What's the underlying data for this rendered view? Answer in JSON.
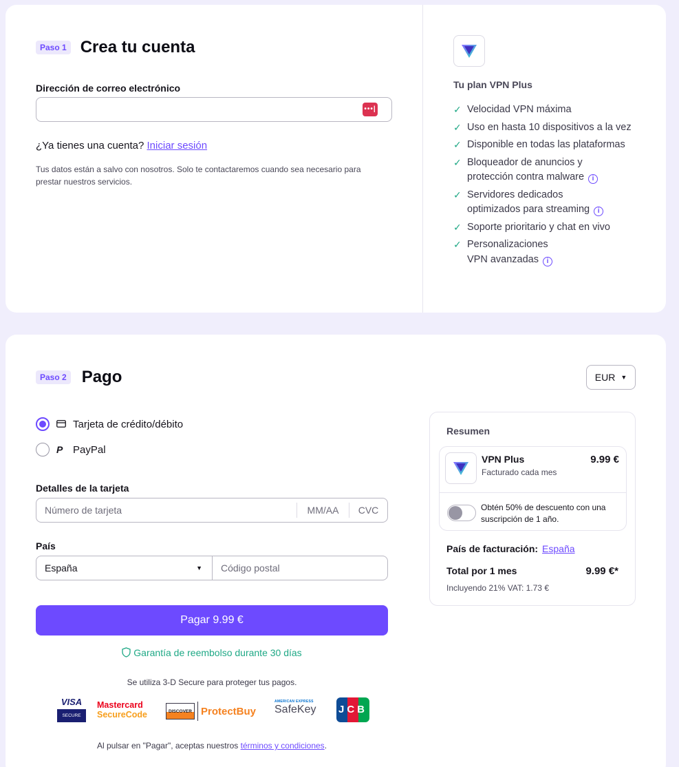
{
  "step1": {
    "badge": "Paso 1",
    "title": "Crea tu cuenta",
    "email_label": "Dirección de correo electrónico",
    "email_value": "",
    "have_account": "¿Ya tienes una cuenta?",
    "sign_in": "Iniciar sesión",
    "privacy": "Tus datos están a salvo con nosotros. Solo te contactaremos cuando sea necesario para prestar nuestros servicios."
  },
  "plan": {
    "title": "Tu plan VPN Plus",
    "features": [
      {
        "text": "Velocidad VPN máxima",
        "info": false
      },
      {
        "text": "Uso en hasta 10 dispositivos a la vez",
        "info": false
      },
      {
        "text": "Disponible en todas las plataformas",
        "info": false
      },
      {
        "text": "Bloqueador de anuncios y protección contra malware",
        "info": true
      },
      {
        "text": "Servidores dedicados optimizados para streaming",
        "info": true
      },
      {
        "text": "Soporte prioritario y chat en vivo",
        "info": false
      },
      {
        "text": "Personalizaciones VPN avanzadas",
        "info": true
      }
    ]
  },
  "step2": {
    "badge": "Paso 2",
    "title": "Pago",
    "currency": "EUR",
    "method_card": "Tarjeta de crédito/débito",
    "method_paypal": "PayPal",
    "card_label": "Detalles de la tarjeta",
    "card_number_ph": "Número de tarjeta",
    "expiry_ph": "MM/AA",
    "cvc_ph": "CVC",
    "country_label": "País",
    "country_value": "España",
    "postal_ph": "Código postal",
    "pay_button": "Pagar 9.99 €",
    "guarantee": "Garantía de reembolso durante 30 días",
    "secure_note": "Se utiliza 3-D Secure para proteger tus pagos.",
    "terms_prefix": "Al pulsar en \"Pagar\", aceptas nuestros",
    "terms_link": "términos y condiciones",
    "terms_suffix": "."
  },
  "logos": {
    "visa": "VISA",
    "visa_sub": "SECURE",
    "mc1": "Mastercard",
    "mc2": "SecureCode",
    "discover": "DISCOVER",
    "protectbuy": "ProtectBuy",
    "amex_top": "AMERICAN EXPRESS",
    "safekey": "SafeKey",
    "jcb": "JCB"
  },
  "summary": {
    "title": "Resumen",
    "plan_name": "VPN Plus",
    "plan_price": "9.99 €",
    "billed": "Facturado cada mes",
    "discount": "Obtén 50% de descuento con una suscripción de 1 año.",
    "billing_country_label": "País de facturación:",
    "billing_country": "España",
    "total_label": "Total por 1 mes",
    "total_value": "9.99 €*",
    "vat": "Incluyendo 21% VAT: 1.73 €"
  },
  "colors": {
    "accent": "#6d4aff",
    "success": "#1ea885",
    "background": "#f0eefc"
  }
}
